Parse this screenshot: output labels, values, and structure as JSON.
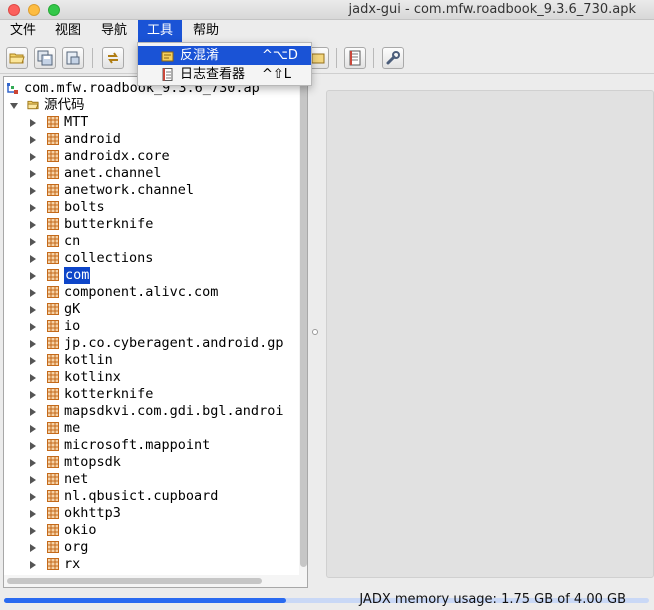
{
  "window": {
    "title": "jadx-gui - com.mfw.roadbook_9.3.6_730.apk"
  },
  "menubar": {
    "items": [
      {
        "label": "文件"
      },
      {
        "label": "视图"
      },
      {
        "label": "导航"
      },
      {
        "label": "工具"
      },
      {
        "label": "帮助"
      }
    ],
    "active_index": 3
  },
  "tools_menu": {
    "items": [
      {
        "label": "反混淆",
        "shortcut": "^⌥D",
        "icon": "deobfuscation-icon",
        "selected": true
      },
      {
        "label": "日志查看器",
        "shortcut": "^⇧L",
        "icon": "log-viewer-icon",
        "selected": false
      }
    ]
  },
  "toolbar": {
    "buttons": [
      {
        "icon": "open-folder-icon"
      },
      {
        "icon": "save-all-icon"
      },
      {
        "icon": "export-icon"
      },
      {
        "icon": "sync-icon"
      },
      {
        "icon": "preferences-icon"
      },
      {
        "icon": "log-icon"
      },
      {
        "icon": "wrench-icon"
      }
    ]
  },
  "tree": {
    "root_label": "com.mfw.roadbook_9.3.6_730.ap",
    "source_folder_label": "源代码",
    "packages": [
      "MTT",
      "android",
      "androidx.core",
      "anet.channel",
      "anetwork.channel",
      "bolts",
      "butterknife",
      "cn",
      "collections",
      "com",
      "component.alivc.com",
      "gK",
      "io",
      "jp.co.cyberagent.android.gp",
      "kotlin",
      "kotlinx",
      "kotterknife",
      "mapsdkvi.com.gdi.bgl.androi",
      "me",
      "microsoft.mappoint",
      "mtopsdk",
      "net",
      "nl.qbusict.cupboard",
      "okhttp3",
      "okio",
      "org",
      "rx"
    ],
    "selected_package": "com"
  },
  "status": {
    "memory_text": "JADX memory usage: 1.75 GB of 4.00 GB",
    "memory_fraction": 0.4375
  },
  "colors": {
    "accent": "#1a53d6",
    "selection": "#0d45c9",
    "package_icon": "#c46a1b"
  }
}
